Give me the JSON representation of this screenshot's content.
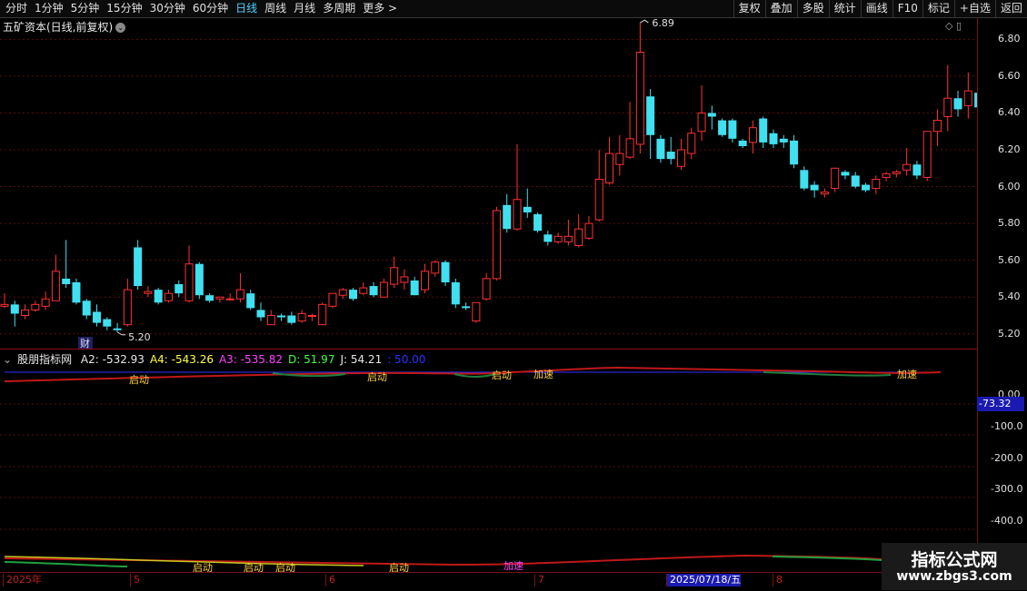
{
  "toolbar": {
    "periods": [
      "分时",
      "1分钟",
      "5分钟",
      "15分钟",
      "30分钟",
      "60分钟",
      "日线",
      "周线",
      "月线",
      "多周期",
      "更多 >"
    ],
    "active_period": "日线",
    "right_buttons": [
      "复权",
      "叠加",
      "多股",
      "统计",
      "画线",
      "F10",
      "标记",
      "+自选",
      "返回"
    ]
  },
  "main": {
    "title": "五矿资本(日线,前复权)",
    "title_button": "⌄",
    "header_icons": "◇ ▯",
    "y_axis": [
      "6.80",
      "6.60",
      "6.40",
      "6.20",
      "6.00",
      "5.80",
      "5.60",
      "5.40",
      "5.20"
    ],
    "high_marker": "6.89",
    "low_marker": "5.20",
    "fin_badge": "财"
  },
  "indicator": {
    "name": "股朋指标网",
    "values": [
      {
        "text": "A2: -532.93",
        "color": "#e8e8e8"
      },
      {
        "text": "A4: -543.26",
        "color": "#ffff40"
      },
      {
        "text": "A3: -535.82",
        "color": "#ff40ff"
      },
      {
        "text": "D: 51.97",
        "color": "#40ff40"
      },
      {
        "text": "J: 54.21",
        "color": "#e8e8e8"
      },
      {
        "text": ": 50.00",
        "color": "#3030ff"
      }
    ],
    "y_axis": [
      "0.00",
      "-100.0",
      "-200.0",
      "-300.0",
      "-400.0"
    ],
    "current": "-73.32",
    "signals": [
      {
        "text": "启动",
        "color": "#ffd040"
      },
      {
        "text": "启动",
        "color": "#ffd040"
      },
      {
        "text": "启动",
        "color": "#ffd040"
      },
      {
        "text": "加速",
        "color": "#ffd040"
      },
      {
        "text": "加速",
        "color": "#ffd040"
      }
    ],
    "bottom_signals": [
      {
        "text": "启动",
        "color": "#ffd040"
      },
      {
        "text": "启动",
        "color": "#ffd040"
      },
      {
        "text": "启动",
        "color": "#ffd040"
      },
      {
        "text": "启动",
        "color": "#ffd040"
      },
      {
        "text": "加速",
        "color": "#ff40ff"
      }
    ]
  },
  "dates": [
    "2025年",
    "5",
    "6",
    "7",
    "2025/07/18/五",
    "8"
  ],
  "watermark": {
    "title": "指标公式网",
    "url": "www.zbgs3.com"
  },
  "colors": {
    "up": "#ff3030",
    "down": "#40e0f0",
    "grid": "#5a0d0d"
  },
  "chart_data": {
    "type": "candlestick",
    "ylim": [
      5.12,
      6.92
    ],
    "candles": [
      [
        5.35,
        5.42,
        5.36,
        5.34
      ],
      [
        5.36,
        5.38,
        5.31,
        5.24
      ],
      [
        5.3,
        5.36,
        5.33,
        5.28
      ],
      [
        5.33,
        5.38,
        5.36,
        5.32
      ],
      [
        5.35,
        5.43,
        5.39,
        5.33
      ],
      [
        5.38,
        5.63,
        5.54,
        5.38
      ],
      [
        5.5,
        5.71,
        5.47,
        5.45
      ],
      [
        5.48,
        5.5,
        5.37,
        5.36
      ],
      [
        5.38,
        5.39,
        5.3,
        5.28
      ],
      [
        5.32,
        5.36,
        5.26,
        5.24
      ],
      [
        5.28,
        5.29,
        5.24,
        5.22
      ],
      [
        5.23,
        5.26,
        5.22,
        5.21
      ],
      [
        5.25,
        5.5,
        5.44,
        5.24
      ],
      [
        5.67,
        5.71,
        5.46,
        5.44
      ],
      [
        5.42,
        5.46,
        5.43,
        5.4
      ],
      [
        5.44,
        5.45,
        5.37,
        5.36
      ],
      [
        5.38,
        5.44,
        5.42,
        5.37
      ],
      [
        5.47,
        5.49,
        5.42,
        5.4
      ],
      [
        5.38,
        5.68,
        5.58,
        5.37
      ],
      [
        5.58,
        5.59,
        5.41,
        5.39
      ],
      [
        5.41,
        5.42,
        5.38,
        5.37
      ],
      [
        5.39,
        5.4,
        5.4,
        5.37
      ],
      [
        5.39,
        5.42,
        5.39,
        5.38
      ],
      [
        5.39,
        5.53,
        5.44,
        5.37
      ],
      [
        5.42,
        5.44,
        5.34,
        5.33
      ],
      [
        5.33,
        5.37,
        5.29,
        5.27
      ],
      [
        5.25,
        5.33,
        5.3,
        5.25
      ],
      [
        5.3,
        5.31,
        5.29,
        5.27
      ],
      [
        5.3,
        5.32,
        5.26,
        5.25
      ],
      [
        5.27,
        5.33,
        5.31,
        5.26
      ],
      [
        5.3,
        5.31,
        5.3,
        5.27
      ],
      [
        5.25,
        5.37,
        5.36,
        5.25
      ],
      [
        5.35,
        5.42,
        5.42,
        5.34
      ],
      [
        5.41,
        5.45,
        5.44,
        5.39
      ],
      [
        5.44,
        5.45,
        5.39,
        5.38
      ],
      [
        5.42,
        5.48,
        5.45,
        5.41
      ],
      [
        5.46,
        5.48,
        5.41,
        5.4
      ],
      [
        5.4,
        5.5,
        5.48,
        5.4
      ],
      [
        5.47,
        5.62,
        5.56,
        5.45
      ],
      [
        5.48,
        5.55,
        5.51,
        5.44
      ],
      [
        5.49,
        5.51,
        5.41,
        5.41
      ],
      [
        5.44,
        5.58,
        5.54,
        5.42
      ],
      [
        5.53,
        5.6,
        5.59,
        5.51
      ],
      [
        5.59,
        5.6,
        5.48,
        5.46
      ],
      [
        5.48,
        5.5,
        5.36,
        5.34
      ],
      [
        5.35,
        5.37,
        5.34,
        5.33
      ],
      [
        5.27,
        5.37,
        5.37,
        5.26
      ],
      [
        5.39,
        5.53,
        5.5,
        5.38
      ],
      [
        5.5,
        5.89,
        5.87,
        5.49
      ],
      [
        5.9,
        5.96,
        5.77,
        5.75
      ],
      [
        5.77,
        6.23,
        5.93,
        5.76
      ],
      [
        5.89,
        5.99,
        5.86,
        5.83
      ],
      [
        5.85,
        5.86,
        5.76,
        5.75
      ],
      [
        5.74,
        5.76,
        5.7,
        5.68
      ],
      [
        5.7,
        5.75,
        5.73,
        5.69
      ],
      [
        5.7,
        5.82,
        5.73,
        5.68
      ],
      [
        5.68,
        5.85,
        5.77,
        5.67
      ],
      [
        5.72,
        5.84,
        5.8,
        5.71
      ],
      [
        5.82,
        6.2,
        6.04,
        5.81
      ],
      [
        6.02,
        6.27,
        6.18,
        6.01
      ],
      [
        6.12,
        6.28,
        6.18,
        6.06
      ],
      [
        6.16,
        6.46,
        6.26,
        6.15
      ],
      [
        6.23,
        6.89,
        6.73,
        6.18
      ],
      [
        6.49,
        6.53,
        6.28,
        6.15
      ],
      [
        6.26,
        6.28,
        6.15,
        6.13
      ],
      [
        6.19,
        6.27,
        6.15,
        6.12
      ],
      [
        6.11,
        6.26,
        6.2,
        6.09
      ],
      [
        6.18,
        6.32,
        6.29,
        6.15
      ],
      [
        6.3,
        6.55,
        6.4,
        6.25
      ],
      [
        6.4,
        6.44,
        6.38,
        6.31
      ],
      [
        6.36,
        6.37,
        6.28,
        6.27
      ],
      [
        6.36,
        6.37,
        6.26,
        6.24
      ],
      [
        6.25,
        6.26,
        6.22,
        6.21
      ],
      [
        6.24,
        6.36,
        6.32,
        6.18
      ],
      [
        6.37,
        6.38,
        6.24,
        6.21
      ],
      [
        6.29,
        6.31,
        6.23,
        6.21
      ],
      [
        6.26,
        6.28,
        6.24,
        6.21
      ],
      [
        6.25,
        6.28,
        6.12,
        6.1
      ],
      [
        6.09,
        6.11,
        5.99,
        5.98
      ],
      [
        6.01,
        6.03,
        5.98,
        5.94
      ],
      [
        5.96,
        5.99,
        5.97,
        5.94
      ],
      [
        5.99,
        6.09,
        6.1,
        5.97
      ],
      [
        6.08,
        6.09,
        6.06,
        6.04
      ],
      [
        6.06,
        6.08,
        6.0,
        5.99
      ],
      [
        6.01,
        6.02,
        5.98,
        5.97
      ],
      [
        5.99,
        6.06,
        6.04,
        5.96
      ],
      [
        6.05,
        6.08,
        6.07,
        6.03
      ],
      [
        6.07,
        6.09,
        6.08,
        6.05
      ],
      [
        6.09,
        6.21,
        6.12,
        6.06
      ],
      [
        6.12,
        6.14,
        6.06,
        6.04
      ],
      [
        6.05,
        6.3,
        6.3,
        6.03
      ],
      [
        6.3,
        6.42,
        6.36,
        6.22
      ],
      [
        6.38,
        6.66,
        6.48,
        6.3
      ],
      [
        6.48,
        6.52,
        6.42,
        6.38
      ],
      [
        6.44,
        6.62,
        6.52,
        6.37
      ],
      [
        6.51,
        6.52,
        6.43,
        6.39
      ],
      [
        6.44,
        6.44,
        6.44,
        6.44
      ]
    ]
  }
}
